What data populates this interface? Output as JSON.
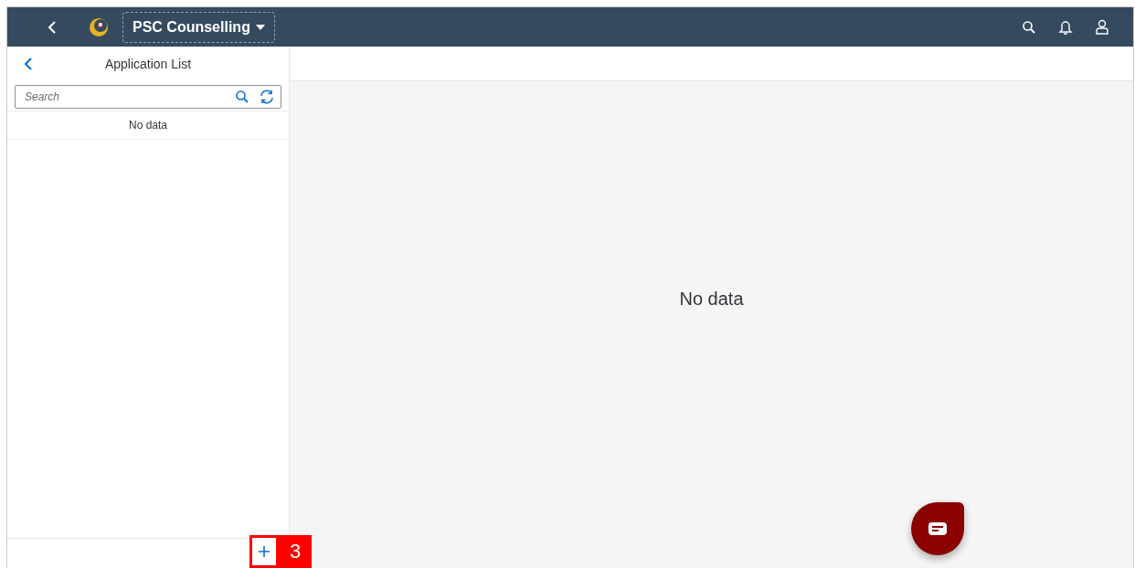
{
  "shell": {
    "title": "PSC Counselling"
  },
  "list": {
    "title": "Application List",
    "search": {
      "placeholder": "Search"
    },
    "empty_text": "No data"
  },
  "detail": {
    "empty_text": "No data"
  },
  "callout": {
    "number": "3"
  }
}
